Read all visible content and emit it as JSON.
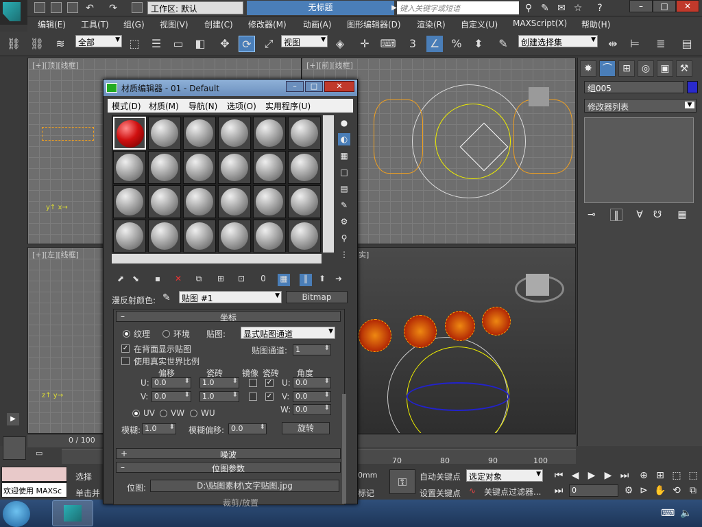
{
  "title": {
    "workspace_label": "工作区: 默认",
    "doc_title": "无标题",
    "search_placeholder": "键入关键字或短语"
  },
  "menu": [
    "编辑(E)",
    "工具(T)",
    "组(G)",
    "视图(V)",
    "创建(C)",
    "修改器(M)",
    "动画(A)",
    "图形编辑器(D)",
    "渲染(R)",
    "自定义(U)",
    "MAXScript(X)",
    "帮助(H)"
  ],
  "toolbar": {
    "filter_select": "全部",
    "ref_coord_select": "视图",
    "selection_set": "创建选择集",
    "snap_number": "3",
    "percent_snap": "%"
  },
  "viewports": {
    "top": "[+][顶][线框]",
    "front": "[+][前][线框]",
    "left": "[+][左][线框]",
    "persp_fragment": "实]"
  },
  "command_panel": {
    "object_name": "组005",
    "object_color": "#2a2acc",
    "modifier_list": "修改器列表"
  },
  "material_editor": {
    "title": "材质编辑器 - 01 - Default",
    "menu": [
      "模式(D)",
      "材质(M)",
      "导航(N)",
      "选项(O)",
      "实用程序(U)"
    ],
    "diffuse_label": "漫反射颜色:",
    "map_name": "贴图 #1",
    "map_type": "Bitmap",
    "coords_rollout": "坐标",
    "texture_label": "纹理",
    "environ_label": "环境",
    "map_label": "贴图:",
    "map_channel_select": "显式贴图通道",
    "show_back_label": "在背面显示贴图",
    "real_world_label": "使用真实世界比例",
    "map_channel_label": "贴图通道:",
    "map_channel_value": "1",
    "offset_header": "偏移",
    "tiling_header": "瓷砖",
    "mirror_header": "镜像",
    "tile_header": "瓷砖",
    "angle_header": "角度",
    "u_label": "U:",
    "v_label": "V:",
    "w_label": "W:",
    "offset_u": "0.0",
    "offset_v": "0.0",
    "tiling_u": "1.0",
    "tiling_v": "1.0",
    "angle_u": "0.0",
    "angle_v": "0.0",
    "angle_w": "0.0",
    "uv_label": "UV",
    "vw_label": "VW",
    "wu_label": "WU",
    "blur_label": "模糊:",
    "blur_value": "1.0",
    "blur_offset_label": "模糊偏移:",
    "blur_offset_value": "0.0",
    "rotate_button": "旋转",
    "noise_rollout": "噪波",
    "bitmap_params_rollout": "位图参数",
    "bitmap_label": "位图:",
    "bitmap_path": "D:\\贴图素材\\文字贴图.jpg",
    "tiling_cut_label": "裁剪/放置"
  },
  "bottom": {
    "frame_counter": "0 / 100",
    "ruler_ticks": [
      "70",
      "80",
      "90",
      "100"
    ],
    "welcome": "欢迎使用 MAXSc",
    "select_label": "选择",
    "click_label": "单击并",
    "dim_value": "0mm",
    "addtime_label": "标记",
    "auto_key": "自动关键点",
    "set_key": "设置关键点",
    "selected_object": "选定对象",
    "key_filter": "关键点过滤器...",
    "frame_value": "0"
  }
}
